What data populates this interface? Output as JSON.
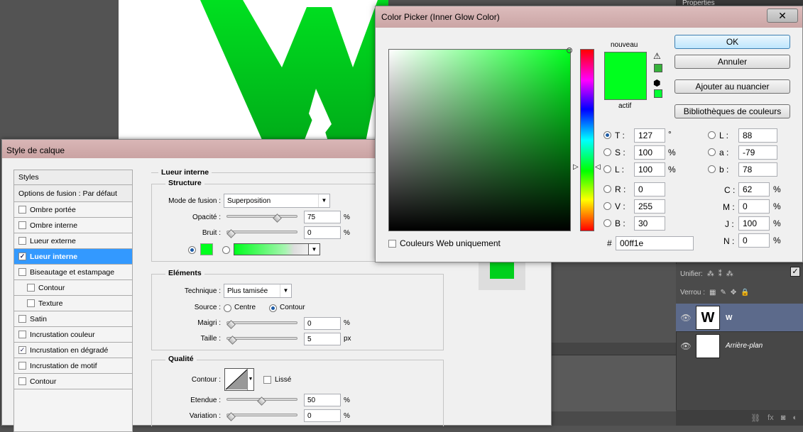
{
  "colors": {
    "glow": "#00ff1e",
    "accent": "#3399ff",
    "doc_green": "#00c020"
  },
  "right_panel": {
    "tab_label": "Properties",
    "unify_label": "Unifier:",
    "lock_label": "Verrou :",
    "layers": [
      {
        "name": "W",
        "selected": true
      },
      {
        "name": "Arrière-plan",
        "selected": false
      }
    ],
    "footer_icons": [
      "link-icon",
      "fx-icon",
      "mask-icon",
      "adjustment-icon"
    ]
  },
  "layer_style": {
    "title": "Style de calque",
    "list": {
      "styles_header": "Styles",
      "blend_options": "Options de fusion : Par défaut",
      "items": [
        {
          "label": "Ombre portée",
          "checked": false,
          "indent": false,
          "active": false
        },
        {
          "label": "Ombre interne",
          "checked": false,
          "indent": false,
          "active": false
        },
        {
          "label": "Lueur externe",
          "checked": false,
          "indent": false,
          "active": false
        },
        {
          "label": "Lueur interne",
          "checked": true,
          "indent": false,
          "active": true
        },
        {
          "label": "Biseautage et estampage",
          "checked": false,
          "indent": false,
          "active": false
        },
        {
          "label": "Contour",
          "checked": false,
          "indent": true,
          "active": false
        },
        {
          "label": "Texture",
          "checked": false,
          "indent": true,
          "active": false
        },
        {
          "label": "Satin",
          "checked": false,
          "indent": false,
          "active": false
        },
        {
          "label": "Incrustation couleur",
          "checked": false,
          "indent": false,
          "active": false
        },
        {
          "label": "Incrustation en dégradé",
          "checked": true,
          "indent": false,
          "active": false
        },
        {
          "label": "Incrustation de motif",
          "checked": false,
          "indent": false,
          "active": false
        },
        {
          "label": "Contour",
          "checked": false,
          "indent": false,
          "active": false
        }
      ]
    },
    "section_title": "Lueur interne",
    "structure": {
      "title": "Structure",
      "blend_mode_label": "Mode de fusion :",
      "blend_mode_value": "Superposition",
      "opacity_label": "Opacité :",
      "opacity_value": "75",
      "opacity_pct": 75,
      "noise_label": "Bruit :",
      "noise_value": "0",
      "noise_pct": 0,
      "pct": "%"
    },
    "elements": {
      "title": "Eléments",
      "technique_label": "Technique :",
      "technique_value": "Plus tamisée",
      "source_label": "Source :",
      "source_center": "Centre",
      "source_edge": "Contour",
      "choke_label": "Maigri :",
      "choke_value": "0",
      "choke_pct": 0,
      "size_label": "Taille :",
      "size_value": "5",
      "size_unit": "px",
      "pct": "%"
    },
    "quality": {
      "title": "Qualité",
      "contour_label": "Contour :",
      "antialias_label": "Lissé",
      "range_label": "Etendue :",
      "range_value": "50",
      "range_pct": 50,
      "jitter_label": "Variation :",
      "jitter_value": "0",
      "jitter_pct": 0,
      "pct": "%"
    }
  },
  "color_picker": {
    "title": "Color Picker (Inner Glow Color)",
    "new_label": "nouveau",
    "current_label": "actif",
    "ok": "OK",
    "cancel": "Annuler",
    "add_swatch": "Ajouter au nuancier",
    "libraries": "Bibliothèques de couleurs",
    "web_only": "Couleurs Web uniquement",
    "hex_symbol": "#",
    "hex": "00ff1e",
    "hsb": {
      "H": "127",
      "S": "100",
      "B": "100",
      "H_label": "T :",
      "S_label": "S :",
      "B_label": "L :",
      "deg": "°",
      "pct": "%"
    },
    "rgb": {
      "R": "0",
      "G": "255",
      "B": "30",
      "R_label": "R :",
      "G_label": "V :",
      "B_label": "B :"
    },
    "lab": {
      "L": "88",
      "a": "-79",
      "b": "78",
      "L_label": "L :",
      "a_label": "a :",
      "b_label": "b :"
    },
    "cmyk": {
      "C": "62",
      "M": "0",
      "Y": "100",
      "K": "0",
      "C_label": "C :",
      "M_label": "M :",
      "Y_label": "J :",
      "K_label": "N :",
      "pct": "%"
    }
  }
}
